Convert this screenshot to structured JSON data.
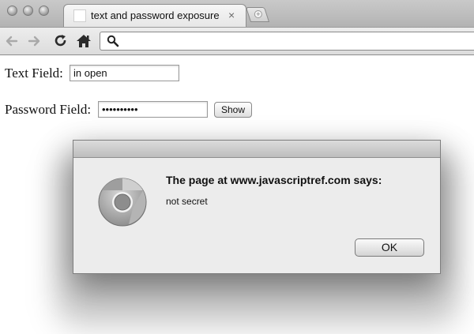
{
  "window": {
    "tab_title": "text and password exposure",
    "tab_close_glyph": "×",
    "new_tab_glyph": "+"
  },
  "toolbar": {
    "back_icon": "arrow-left-icon",
    "forward_icon": "arrow-right-icon",
    "reload_icon": "reload-icon",
    "home_icon": "home-icon",
    "search_icon": "search-icon",
    "url": ""
  },
  "page": {
    "text_field_label": "Text Field:",
    "text_field_value": "in open",
    "password_field_label": "Password Field:",
    "password_field_masked": "••••••••••",
    "show_button_label": "Show"
  },
  "dialog": {
    "heading": "The page at www.javascriptref.com says:",
    "message": "not secret",
    "ok_label": "OK",
    "icon": "chrome-logo-icon"
  }
}
